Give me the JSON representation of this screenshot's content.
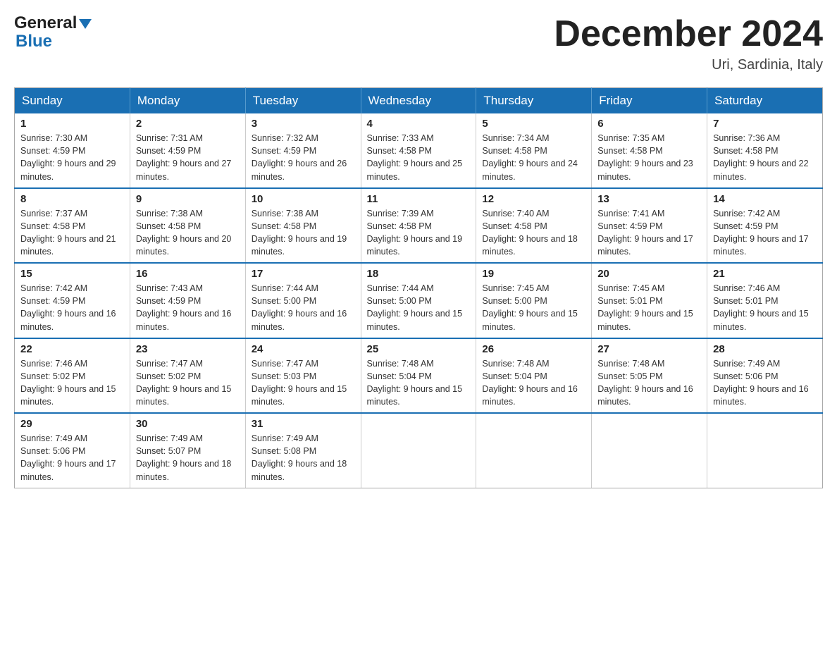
{
  "header": {
    "logo_general": "General",
    "logo_blue": "Blue",
    "month_title": "December 2024",
    "location": "Uri, Sardinia, Italy"
  },
  "calendar": {
    "days_of_week": [
      "Sunday",
      "Monday",
      "Tuesday",
      "Wednesday",
      "Thursday",
      "Friday",
      "Saturday"
    ],
    "weeks": [
      [
        {
          "day": "1",
          "sunrise": "7:30 AM",
          "sunset": "4:59 PM",
          "daylight": "9 hours and 29 minutes."
        },
        {
          "day": "2",
          "sunrise": "7:31 AM",
          "sunset": "4:59 PM",
          "daylight": "9 hours and 27 minutes."
        },
        {
          "day": "3",
          "sunrise": "7:32 AM",
          "sunset": "4:59 PM",
          "daylight": "9 hours and 26 minutes."
        },
        {
          "day": "4",
          "sunrise": "7:33 AM",
          "sunset": "4:58 PM",
          "daylight": "9 hours and 25 minutes."
        },
        {
          "day": "5",
          "sunrise": "7:34 AM",
          "sunset": "4:58 PM",
          "daylight": "9 hours and 24 minutes."
        },
        {
          "day": "6",
          "sunrise": "7:35 AM",
          "sunset": "4:58 PM",
          "daylight": "9 hours and 23 minutes."
        },
        {
          "day": "7",
          "sunrise": "7:36 AM",
          "sunset": "4:58 PM",
          "daylight": "9 hours and 22 minutes."
        }
      ],
      [
        {
          "day": "8",
          "sunrise": "7:37 AM",
          "sunset": "4:58 PM",
          "daylight": "9 hours and 21 minutes."
        },
        {
          "day": "9",
          "sunrise": "7:38 AM",
          "sunset": "4:58 PM",
          "daylight": "9 hours and 20 minutes."
        },
        {
          "day": "10",
          "sunrise": "7:38 AM",
          "sunset": "4:58 PM",
          "daylight": "9 hours and 19 minutes."
        },
        {
          "day": "11",
          "sunrise": "7:39 AM",
          "sunset": "4:58 PM",
          "daylight": "9 hours and 19 minutes."
        },
        {
          "day": "12",
          "sunrise": "7:40 AM",
          "sunset": "4:58 PM",
          "daylight": "9 hours and 18 minutes."
        },
        {
          "day": "13",
          "sunrise": "7:41 AM",
          "sunset": "4:59 PM",
          "daylight": "9 hours and 17 minutes."
        },
        {
          "day": "14",
          "sunrise": "7:42 AM",
          "sunset": "4:59 PM",
          "daylight": "9 hours and 17 minutes."
        }
      ],
      [
        {
          "day": "15",
          "sunrise": "7:42 AM",
          "sunset": "4:59 PM",
          "daylight": "9 hours and 16 minutes."
        },
        {
          "day": "16",
          "sunrise": "7:43 AM",
          "sunset": "4:59 PM",
          "daylight": "9 hours and 16 minutes."
        },
        {
          "day": "17",
          "sunrise": "7:44 AM",
          "sunset": "5:00 PM",
          "daylight": "9 hours and 16 minutes."
        },
        {
          "day": "18",
          "sunrise": "7:44 AM",
          "sunset": "5:00 PM",
          "daylight": "9 hours and 15 minutes."
        },
        {
          "day": "19",
          "sunrise": "7:45 AM",
          "sunset": "5:00 PM",
          "daylight": "9 hours and 15 minutes."
        },
        {
          "day": "20",
          "sunrise": "7:45 AM",
          "sunset": "5:01 PM",
          "daylight": "9 hours and 15 minutes."
        },
        {
          "day": "21",
          "sunrise": "7:46 AM",
          "sunset": "5:01 PM",
          "daylight": "9 hours and 15 minutes."
        }
      ],
      [
        {
          "day": "22",
          "sunrise": "7:46 AM",
          "sunset": "5:02 PM",
          "daylight": "9 hours and 15 minutes."
        },
        {
          "day": "23",
          "sunrise": "7:47 AM",
          "sunset": "5:02 PM",
          "daylight": "9 hours and 15 minutes."
        },
        {
          "day": "24",
          "sunrise": "7:47 AM",
          "sunset": "5:03 PM",
          "daylight": "9 hours and 15 minutes."
        },
        {
          "day": "25",
          "sunrise": "7:48 AM",
          "sunset": "5:04 PM",
          "daylight": "9 hours and 15 minutes."
        },
        {
          "day": "26",
          "sunrise": "7:48 AM",
          "sunset": "5:04 PM",
          "daylight": "9 hours and 16 minutes."
        },
        {
          "day": "27",
          "sunrise": "7:48 AM",
          "sunset": "5:05 PM",
          "daylight": "9 hours and 16 minutes."
        },
        {
          "day": "28",
          "sunrise": "7:49 AM",
          "sunset": "5:06 PM",
          "daylight": "9 hours and 16 minutes."
        }
      ],
      [
        {
          "day": "29",
          "sunrise": "7:49 AM",
          "sunset": "5:06 PM",
          "daylight": "9 hours and 17 minutes."
        },
        {
          "day": "30",
          "sunrise": "7:49 AM",
          "sunset": "5:07 PM",
          "daylight": "9 hours and 18 minutes."
        },
        {
          "day": "31",
          "sunrise": "7:49 AM",
          "sunset": "5:08 PM",
          "daylight": "9 hours and 18 minutes."
        },
        null,
        null,
        null,
        null
      ]
    ]
  }
}
